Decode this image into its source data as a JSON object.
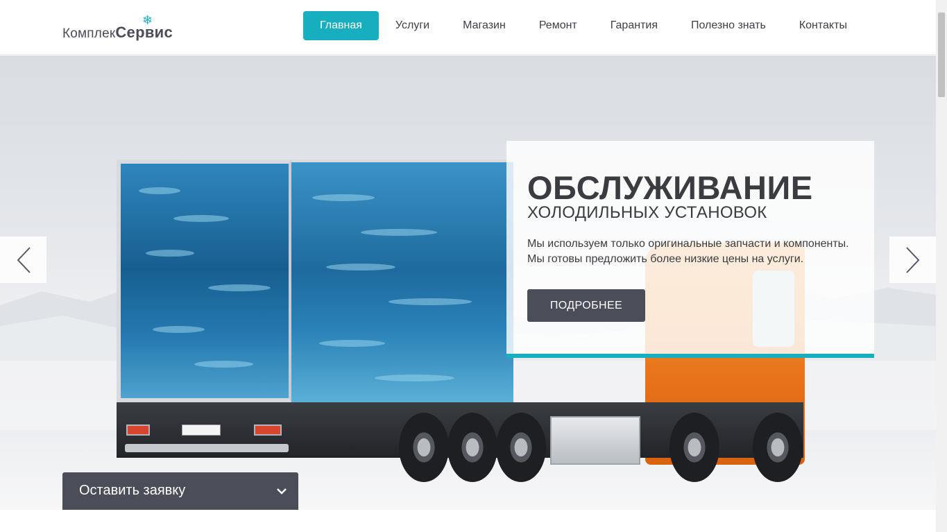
{
  "logo": {
    "part1": "Комплек",
    "part2": "Сервис",
    "snowflake": "❄"
  },
  "nav": {
    "items": [
      {
        "label": "Главная",
        "active": true
      },
      {
        "label": "Услуги",
        "active": false
      },
      {
        "label": "Магазин",
        "active": false
      },
      {
        "label": "Ремонт",
        "active": false
      },
      {
        "label": "Гарантия",
        "active": false
      },
      {
        "label": "Полезно знать",
        "active": false
      },
      {
        "label": "Контакты",
        "active": false
      }
    ]
  },
  "slide": {
    "title": "ОБСЛУЖИВАНИЕ",
    "subtitle": "ХОЛОДИЛЬНЫХ УСТАНОВОК",
    "text_line1": "Мы используем только оригинальные запчасти и компоненты.",
    "text_line2": "Мы готовы предложить более низкие цены на услуги.",
    "button": "ПОДРОБНЕЕ"
  },
  "request": {
    "label": "Оставить заявку"
  },
  "icons": {
    "prev": "chevron-left-icon",
    "next": "chevron-right-icon",
    "expand": "chevron-down-icon",
    "logo_mark": "snowflake-icon"
  },
  "colors": {
    "accent": "#17aebf",
    "dark_button": "#4b4d59",
    "text": "#3a3c42"
  }
}
